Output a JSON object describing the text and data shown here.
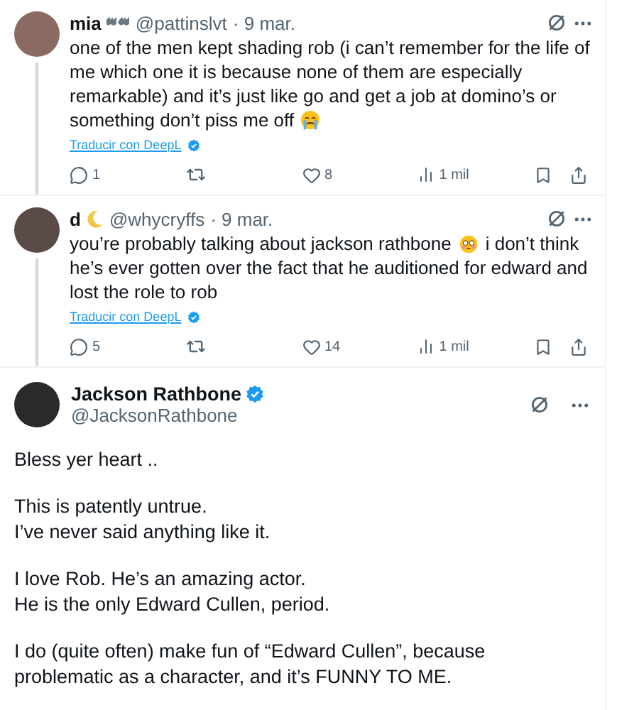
{
  "replies": [
    {
      "name_parts": [
        {
          "kind": "text",
          "text": "mia"
        },
        {
          "kind": "bats"
        }
      ],
      "handle": "@pattinslvt",
      "date": "· 9 mar.",
      "text_parts": [
        {
          "kind": "text",
          "text": "one of the men kept shading rob (i can’t remember for the life of me which one it is because none of them are especially remarkable) and it’s just like go and get a job at domino’s or something don’t piss me off "
        },
        {
          "kind": "crying"
        }
      ],
      "translate": "Traducir con DeepL",
      "replies": "1",
      "likes": "8",
      "views": "1 mil"
    },
    {
      "name_parts": [
        {
          "kind": "text",
          "text": "d"
        },
        {
          "kind": "moon"
        }
      ],
      "handle": "@whycryffs",
      "date": "· 9 mar.",
      "text_parts": [
        {
          "kind": "text",
          "text": "you’re probably talking about jackson rathbone"
        },
        {
          "kind": "flushed"
        },
        {
          "kind": "text",
          "text": "i don’t think he’s ever gotten over the fact that he auditioned for edward and lost the role to rob"
        }
      ],
      "translate": "Traducir con DeepL",
      "replies": "5",
      "likes": "14",
      "views": "1 mil"
    }
  ],
  "main_post": {
    "name": "Jackson Rathbone",
    "verified": true,
    "handle": "@JacksonRathbone",
    "paragraphs": [
      "Bless yer heart ..",
      "This is patently untrue.\nI’ve never said anything like it.",
      "I love Rob.  He’s an amazing actor.\nHe is the only Edward Cullen, period.",
      "I do (quite often) make fun of “Edward Cullen”, because\nproblematic as a character, and it’s FUNNY TO ME."
    ]
  }
}
